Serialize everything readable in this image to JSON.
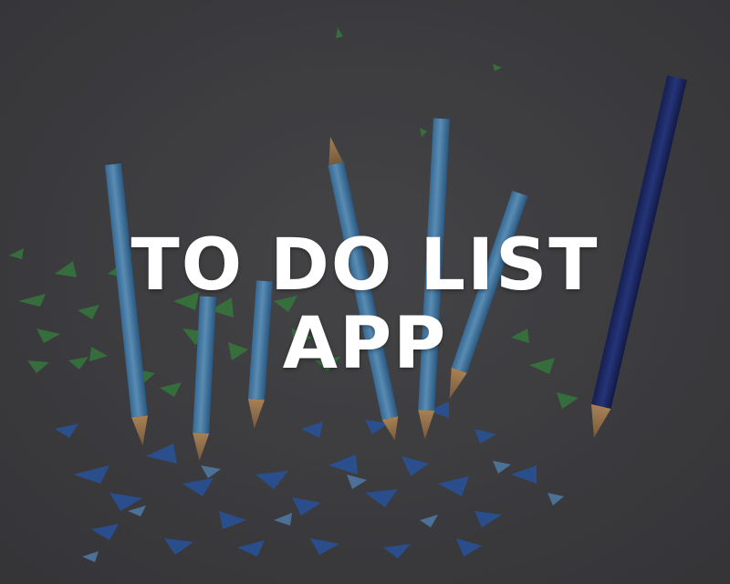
{
  "title": {
    "line1": "TO DO LIST",
    "line2": "APP"
  },
  "colors": {
    "background": "#48474a",
    "title_text": "#ffffff",
    "pencil_light_blue": "#5e9bc9",
    "pencil_dark_blue": "#20307a",
    "shavings_green": "#3f8f43",
    "shavings_blue": "#2f5fae"
  },
  "icons": {
    "hero_image": "colored-pencils-with-shavings"
  }
}
